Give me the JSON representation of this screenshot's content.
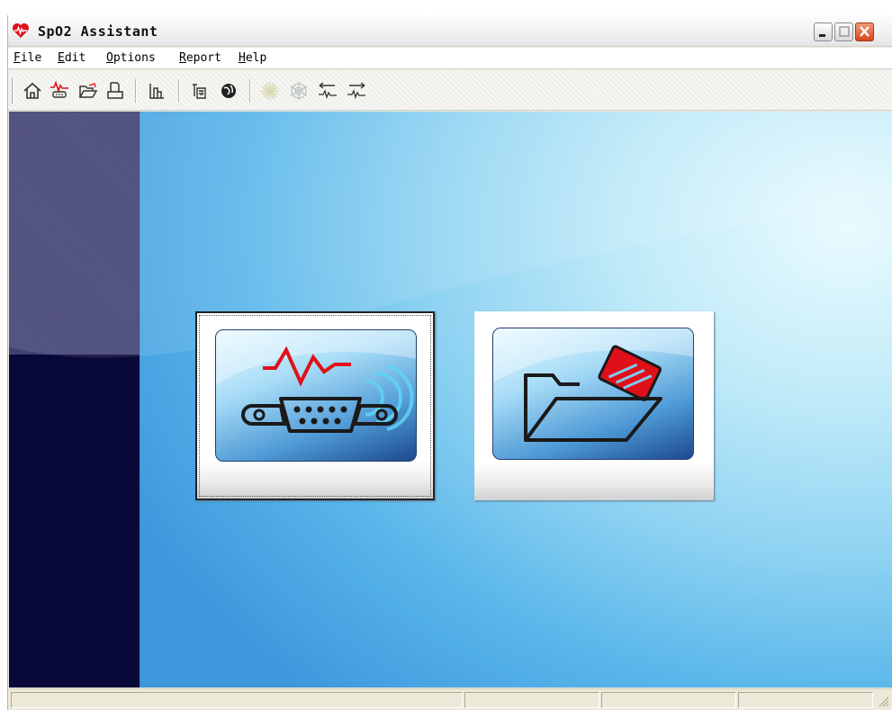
{
  "window": {
    "title": "SpO2 Assistant",
    "app_icon": "heart-wave-icon",
    "buttons": {
      "minimize": "minimize-icon",
      "maximize": "maximize-icon",
      "close": "close-icon"
    }
  },
  "menu": [
    {
      "u": "F",
      "rest": "ile"
    },
    {
      "u": "E",
      "rest": "dit"
    },
    {
      "u": "O",
      "rest": "ptions"
    },
    {
      "u": "R",
      "rest": "eport"
    },
    {
      "u": "H",
      "rest": "elp"
    }
  ],
  "toolbar": [
    {
      "icon": "home-icon",
      "enabled": true
    },
    {
      "icon": "device-waveform-icon",
      "enabled": true
    },
    {
      "icon": "open-folder-icon",
      "enabled": true
    },
    {
      "icon": "print-icon",
      "enabled": true
    },
    {
      "icon": "chart-bars-icon",
      "enabled": true
    },
    {
      "icon": "patient-info-icon",
      "enabled": true
    },
    {
      "icon": "globe-icon",
      "enabled": true
    },
    {
      "icon": "sun-icon",
      "enabled": false
    },
    {
      "icon": "snowflake-icon",
      "enabled": false
    },
    {
      "icon": "wave-left-icon",
      "enabled": true
    },
    {
      "icon": "wave-right-icon",
      "enabled": true
    }
  ],
  "main": {
    "cards": [
      {
        "name": "connect-device-card",
        "icon": "serial-port-waveform-icon",
        "focused": true
      },
      {
        "name": "open-data-card",
        "icon": "folder-card-icon",
        "focused": false
      }
    ]
  },
  "colors": {
    "accent_red": "#e0101a",
    "sidebar": "#09083a",
    "background_blue": "#58b6ea"
  }
}
